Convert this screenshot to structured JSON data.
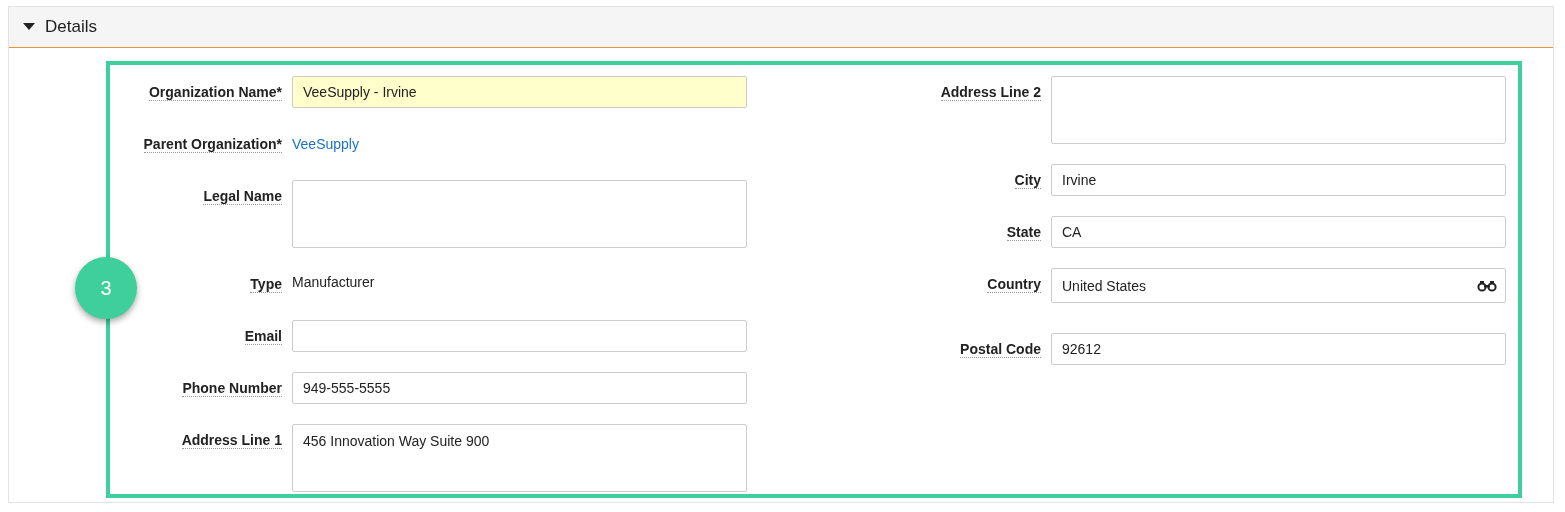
{
  "section": {
    "title": "Details",
    "expanded": true
  },
  "step_badge": "3",
  "left_fields": [
    {
      "kind": "text",
      "label": "Organization Name*",
      "value": "VeeSupply - Irvine",
      "highlighted": true
    },
    {
      "kind": "link",
      "label": "Parent Organization*",
      "value": "VeeSupply"
    },
    {
      "kind": "textarea",
      "label": "Legal Name",
      "highlighted": false
    },
    {
      "kind": "static",
      "label": "Type",
      "value": "Manufacturer"
    },
    {
      "kind": "text",
      "label": "Email",
      "highlighted": false
    },
    {
      "kind": "text",
      "label": "Phone Number",
      "value": "949-555-5555",
      "highlighted": false
    },
    {
      "kind": "textarea",
      "label": "Address Line 1",
      "value": "456 Innovation Way Suite 900",
      "highlighted": false
    }
  ],
  "right_fields": [
    {
      "kind": "textarea",
      "label": "Address Line 2",
      "highlighted": false
    },
    {
      "kind": "text",
      "label": "City",
      "value": "Irvine",
      "highlighted": false
    },
    {
      "kind": "text",
      "label": "State",
      "value": "CA",
      "highlighted": false
    },
    {
      "kind": "lookup",
      "label": "Country",
      "value": "United States",
      "highlighted": false
    },
    {
      "kind": "text",
      "label": "Postal Code",
      "value": "92612",
      "highlighted": false
    }
  ]
}
